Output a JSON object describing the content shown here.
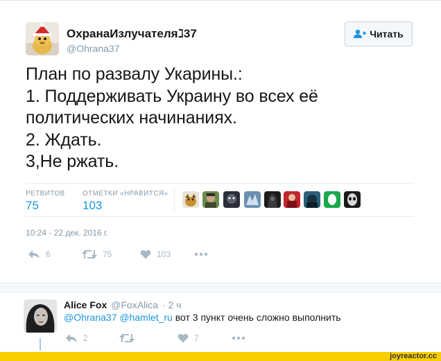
{
  "tweet": {
    "display_name": "ОхранаИзлучателяℷ37",
    "handle": "@Ohrana37",
    "follow_label": "Читать",
    "text_lines": [
      "План по развалу Укарины.:",
      "1. Поддерживать Украину во всех её",
      "политических начинаниях.",
      "2. Ждать.",
      "3,Не ржать."
    ],
    "stats": {
      "retweets_label": "РЕТВИТОВ",
      "retweets_value": "75",
      "likes_label": "ОТМЕТКИ «НРАВИТСЯ»",
      "likes_value": "103"
    },
    "timestamp": "10:24 - 22 дек. 2016 г.",
    "actions": {
      "reply_count": "6",
      "retweet_count": "75",
      "like_count": "103"
    }
  },
  "reply": {
    "display_name": "Alice Fox",
    "handle": "@FoxAlica",
    "time": "· 2 ч",
    "mention1": "@Ohrana37",
    "mention2": "@hamlet_ru",
    "text": " вот 3 пункт очень сложно выполнить",
    "actions": {
      "reply_count": "2",
      "retweet_count": "",
      "like_count": "7"
    }
  },
  "footer": {
    "brand": "joyreactor.cc"
  },
  "colors": {
    "link_blue": "#1b95e0",
    "muted": "#8899a6",
    "icon_gray": "#aab8c2",
    "footer_yellow": "#f8ce00"
  }
}
